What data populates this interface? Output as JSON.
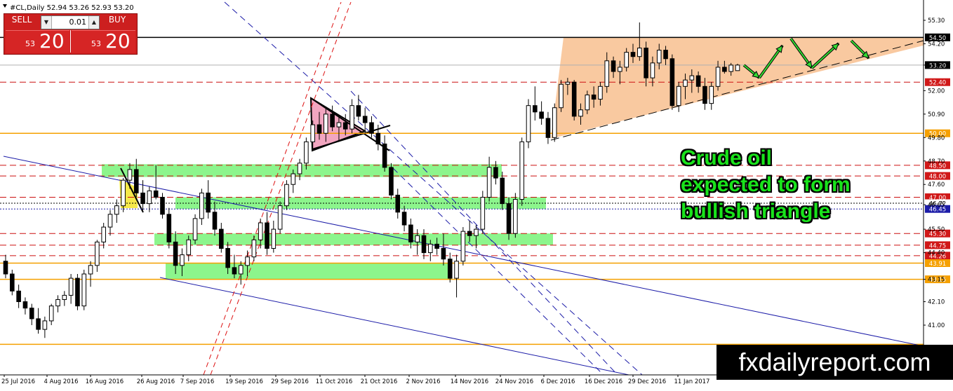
{
  "header": {
    "symbol": "#CL,Daily",
    "ohlc": "52.94 53.26 52.93 53.20"
  },
  "trade_panel": {
    "sell_label": "SELL",
    "buy_label": "BUY",
    "lot": "0.01",
    "sell_prefix": "53",
    "sell_big": "20",
    "buy_prefix": "53",
    "buy_big": "20"
  },
  "annotation": {
    "lines": [
      "Crude oil",
      "expected to form",
      "bullish triangle"
    ]
  },
  "watermark": "fxdailyreport.com",
  "colors": {
    "bull": "#ffffff",
    "bear": "#000000",
    "support_zone": "#8cf58c",
    "triangle_fill": "#f9c9a0",
    "pennant_fill": "#f2a6c0",
    "dashed_red": "#cc1010",
    "orange_line": "#f5a000",
    "channel_blue": "#1c1ca8",
    "arrow_green": "#33dd33",
    "price_tag_current": "#000000"
  },
  "chart_data": {
    "type": "candlestick",
    "title": "#CL,Daily",
    "ylim": [
      39.2,
      55.8
    ],
    "y_ticks": [
      41.0,
      42.1,
      43.15,
      44.4,
      45.5,
      46.65,
      47.6,
      48.7,
      49.8,
      50.9,
      52.0,
      53.2,
      54.2,
      55.3
    ],
    "x_labels": [
      "25 Jul 2016",
      "4 Aug 2016",
      "16 Aug 2016",
      "26 Aug 2016",
      "7 Sep 2016",
      "19 Sep 2016",
      "29 Sep 2016",
      "11 Oct 2016",
      "21 Oct 2016",
      "2 Nov 2016",
      "14 Nov 2016",
      "24 Nov 2016",
      "6 Dec 2016",
      "16 Dec 2016",
      "29 Dec 2016",
      "11 Jan 2017"
    ],
    "h_lines": [
      {
        "price": 54.5,
        "label": "54.50",
        "style": "solid-black"
      },
      {
        "price": 53.2,
        "label": "53.20",
        "style": "current"
      },
      {
        "price": 52.4,
        "label": "52.40",
        "style": "dashed-red"
      },
      {
        "price": 50.0,
        "label": "50.00",
        "style": "solid-orange"
      },
      {
        "price": 48.5,
        "label": "48.50",
        "style": "dashed-red"
      },
      {
        "price": 48.0,
        "label": "48.00",
        "style": "dashed-red"
      },
      {
        "price": 47.0,
        "label": "47.00",
        "style": "dashed-red"
      },
      {
        "price": 46.72,
        "label": "46.72",
        "style": "dotted-black"
      },
      {
        "price": 46.45,
        "label": "46.45",
        "style": "dotted-navy"
      },
      {
        "price": 45.3,
        "label": "45.30",
        "style": "dashed-red"
      },
      {
        "price": 44.75,
        "label": "44.75",
        "style": "dashed-red"
      },
      {
        "price": 44.26,
        "label": "44.26",
        "style": "dashed-red"
      },
      {
        "price": 43.91,
        "label": "43.91",
        "style": "solid-orange"
      },
      {
        "price": 43.15,
        "label": "43.15",
        "style": "solid-orange"
      },
      {
        "price": 40.1,
        "label": "",
        "style": "solid-orange"
      }
    ],
    "zones": [
      {
        "from": 47.95,
        "to": 48.55
      },
      {
        "from": 46.45,
        "to": 47.0
      },
      {
        "from": 44.75,
        "to": 45.3
      },
      {
        "from": 43.15,
        "to": 43.91
      }
    ],
    "candles": [
      [
        44.0,
        44.3,
        43.2,
        43.4
      ],
      [
        43.4,
        43.6,
        42.4,
        42.6
      ],
      [
        42.6,
        42.9,
        41.8,
        42.1
      ],
      [
        42.1,
        42.3,
        41.5,
        41.8
      ],
      [
        41.8,
        42.0,
        41.0,
        41.3
      ],
      [
        41.3,
        41.8,
        40.6,
        40.8
      ],
      [
        40.8,
        41.4,
        40.4,
        41.2
      ],
      [
        41.2,
        42.0,
        41.0,
        41.9
      ],
      [
        41.9,
        42.4,
        41.6,
        42.2
      ],
      [
        42.2,
        42.6,
        41.9,
        42.4
      ],
      [
        42.4,
        43.4,
        42.0,
        43.2
      ],
      [
        43.2,
        43.4,
        41.7,
        41.9
      ],
      [
        41.9,
        43.6,
        41.7,
        43.4
      ],
      [
        43.4,
        44.0,
        42.8,
        43.8
      ],
      [
        43.8,
        45.0,
        43.5,
        44.9
      ],
      [
        44.9,
        45.8,
        44.6,
        45.6
      ],
      [
        45.6,
        46.4,
        45.2,
        46.2
      ],
      [
        46.2,
        46.9,
        45.8,
        46.6
      ],
      [
        46.6,
        47.9,
        46.3,
        47.8
      ],
      [
        47.8,
        48.6,
        47.4,
        48.3
      ],
      [
        48.3,
        48.8,
        47.0,
        47.2
      ],
      [
        47.2,
        47.8,
        46.4,
        46.7
      ],
      [
        46.7,
        47.5,
        46.3,
        47.3
      ],
      [
        47.3,
        48.5,
        46.9,
        47.0
      ],
      [
        47.0,
        47.2,
        46.0,
        46.2
      ],
      [
        46.2,
        46.5,
        44.6,
        44.9
      ],
      [
        44.9,
        45.4,
        43.4,
        43.8
      ],
      [
        43.8,
        44.6,
        43.3,
        44.3
      ],
      [
        44.3,
        45.2,
        44.0,
        45.0
      ],
      [
        45.0,
        46.2,
        44.8,
        46.0
      ],
      [
        46.0,
        47.4,
        45.7,
        47.2
      ],
      [
        47.2,
        47.8,
        46.0,
        46.3
      ],
      [
        46.3,
        46.8,
        45.2,
        45.5
      ],
      [
        45.5,
        45.8,
        44.4,
        44.6
      ],
      [
        44.6,
        44.9,
        43.4,
        43.7
      ],
      [
        43.7,
        44.3,
        43.2,
        43.4
      ],
      [
        43.4,
        44.0,
        42.9,
        43.8
      ],
      [
        43.8,
        44.5,
        43.3,
        44.2
      ],
      [
        44.2,
        45.2,
        44.0,
        45.0
      ],
      [
        45.0,
        46.0,
        44.6,
        45.8
      ],
      [
        45.8,
        46.3,
        44.3,
        44.6
      ],
      [
        44.6,
        45.9,
        44.4,
        45.5
      ],
      [
        45.5,
        46.8,
        45.3,
        46.6
      ],
      [
        46.6,
        47.8,
        46.4,
        47.6
      ],
      [
        47.6,
        48.3,
        47.2,
        48.1
      ],
      [
        48.1,
        48.8,
        47.8,
        48.6
      ],
      [
        48.6,
        49.8,
        48.3,
        49.6
      ],
      [
        49.6,
        50.6,
        49.3,
        50.4
      ],
      [
        50.4,
        51.0,
        49.7,
        50.0
      ],
      [
        50.0,
        51.2,
        49.6,
        50.9
      ],
      [
        50.9,
        51.3,
        50.1,
        50.3
      ],
      [
        50.3,
        50.8,
        49.6,
        50.5
      ],
      [
        50.5,
        50.9,
        49.9,
        50.2
      ],
      [
        50.2,
        51.6,
        50.0,
        51.3
      ],
      [
        51.3,
        51.8,
        50.6,
        50.8
      ],
      [
        50.8,
        51.2,
        50.0,
        50.5
      ],
      [
        50.5,
        50.8,
        49.8,
        50.0
      ],
      [
        50.0,
        50.4,
        49.2,
        49.5
      ],
      [
        49.5,
        49.9,
        48.2,
        48.4
      ],
      [
        48.4,
        48.6,
        46.9,
        47.1
      ],
      [
        47.1,
        47.4,
        46.0,
        46.3
      ],
      [
        46.3,
        46.6,
        45.4,
        45.7
      ],
      [
        45.7,
        46.0,
        44.6,
        44.9
      ],
      [
        44.9,
        45.5,
        44.3,
        45.2
      ],
      [
        45.2,
        45.5,
        44.1,
        44.4
      ],
      [
        44.4,
        45.0,
        44.0,
        44.8
      ],
      [
        44.8,
        45.1,
        44.3,
        44.6
      ],
      [
        44.6,
        45.3,
        43.8,
        44.1
      ],
      [
        44.1,
        44.4,
        43.0,
        43.2
      ],
      [
        43.2,
        44.3,
        42.3,
        44.0
      ],
      [
        44.0,
        45.6,
        43.8,
        45.4
      ],
      [
        45.4,
        45.9,
        44.9,
        45.2
      ],
      [
        45.2,
        45.7,
        44.6,
        45.5
      ],
      [
        45.5,
        47.3,
        45.3,
        47.0
      ],
      [
        47.0,
        48.9,
        46.8,
        48.4
      ],
      [
        48.4,
        48.7,
        47.6,
        47.9
      ],
      [
        47.9,
        48.2,
        46.4,
        46.7
      ],
      [
        46.7,
        47.0,
        45.0,
        45.3
      ],
      [
        45.3,
        47.2,
        45.1,
        46.9
      ],
      [
        46.9,
        49.8,
        46.6,
        49.6
      ],
      [
        49.6,
        51.6,
        49.3,
        51.3
      ],
      [
        51.3,
        52.2,
        50.6,
        51.0
      ],
      [
        51.0,
        51.5,
        50.4,
        50.7
      ],
      [
        50.7,
        51.0,
        49.5,
        49.8
      ],
      [
        49.8,
        51.4,
        49.6,
        51.2
      ],
      [
        51.2,
        52.5,
        51.0,
        52.3
      ],
      [
        52.3,
        52.6,
        51.8,
        52.4
      ],
      [
        52.4,
        52.5,
        50.6,
        50.8
      ],
      [
        50.8,
        51.4,
        50.4,
        51.1
      ],
      [
        51.1,
        52.0,
        50.9,
        51.8
      ],
      [
        51.8,
        52.2,
        51.2,
        51.6
      ],
      [
        51.6,
        52.4,
        51.3,
        52.2
      ],
      [
        52.2,
        53.8,
        51.9,
        53.4
      ],
      [
        53.4,
        53.6,
        52.6,
        52.9
      ],
      [
        52.9,
        53.4,
        52.3,
        53.1
      ],
      [
        53.1,
        54.0,
        52.9,
        53.8
      ],
      [
        53.8,
        54.2,
        53.3,
        53.6
      ],
      [
        53.6,
        55.2,
        53.4,
        54.0
      ],
      [
        54.0,
        54.3,
        52.2,
        52.6
      ],
      [
        52.6,
        53.6,
        52.2,
        53.3
      ],
      [
        53.3,
        54.2,
        53.0,
        53.9
      ],
      [
        53.9,
        54.1,
        53.2,
        53.5
      ],
      [
        53.5,
        53.7,
        51.1,
        51.3
      ],
      [
        51.3,
        52.4,
        51.0,
        52.2
      ],
      [
        52.2,
        52.8,
        51.6,
        52.5
      ],
      [
        52.5,
        53.0,
        51.9,
        52.7
      ],
      [
        52.7,
        52.9,
        51.9,
        52.2
      ],
      [
        52.2,
        52.6,
        51.1,
        51.4
      ],
      [
        51.4,
        52.4,
        51.1,
        52.2
      ],
      [
        52.2,
        53.4,
        52.0,
        53.1
      ],
      [
        53.1,
        53.4,
        52.8,
        52.9
      ],
      [
        52.9,
        53.3,
        52.7,
        53.2
      ],
      [
        52.94,
        53.26,
        52.93,
        53.2
      ]
    ]
  }
}
